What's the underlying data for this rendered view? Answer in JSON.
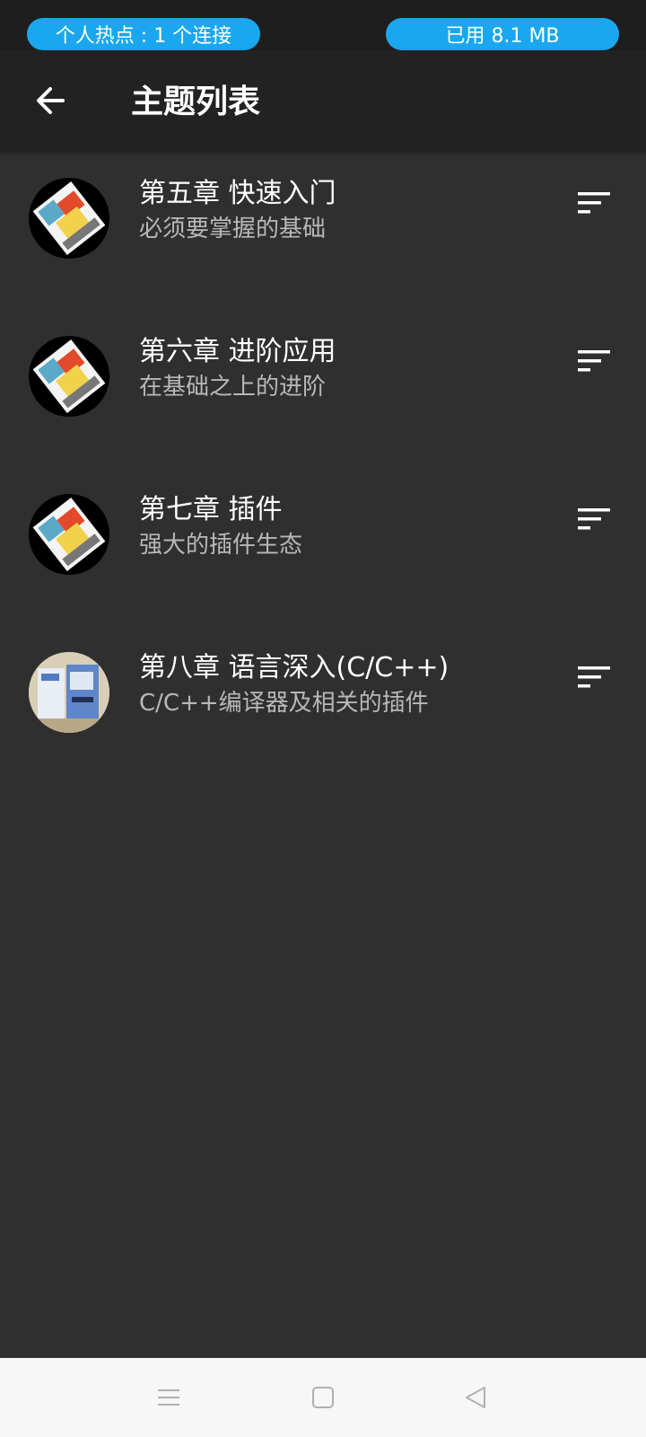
{
  "status_bar": {
    "hotspot_label": "个人热点 : 1 个连接",
    "data_used_label": "已用 8.1 MB",
    "pill_color": "#1aa7ef"
  },
  "app_bar": {
    "back_icon": "arrow-left-icon",
    "title": "主题列表"
  },
  "topics": [
    {
      "title": "第五章 快速入门",
      "subtitle": "必须要掌握的基础",
      "thumbnail": "book-cover-colorful",
      "action_icon": "sort-icon"
    },
    {
      "title": "第六章 进阶应用",
      "subtitle": "在基础之上的进阶",
      "thumbnail": "book-cover-colorful",
      "action_icon": "sort-icon"
    },
    {
      "title": "第七章 插件",
      "subtitle": "强大的插件生态",
      "thumbnail": "book-cover-colorful",
      "action_icon": "sort-icon"
    },
    {
      "title": "第八章 语言深入(C/C++)",
      "subtitle": "C/C++编译器及相关的插件",
      "thumbnail": "book-cover-blue",
      "action_icon": "sort-icon"
    }
  ],
  "nav_bar": {
    "menu_icon": "menu-icon",
    "home_icon": "square-home-icon",
    "back_icon": "triangle-back-icon"
  }
}
